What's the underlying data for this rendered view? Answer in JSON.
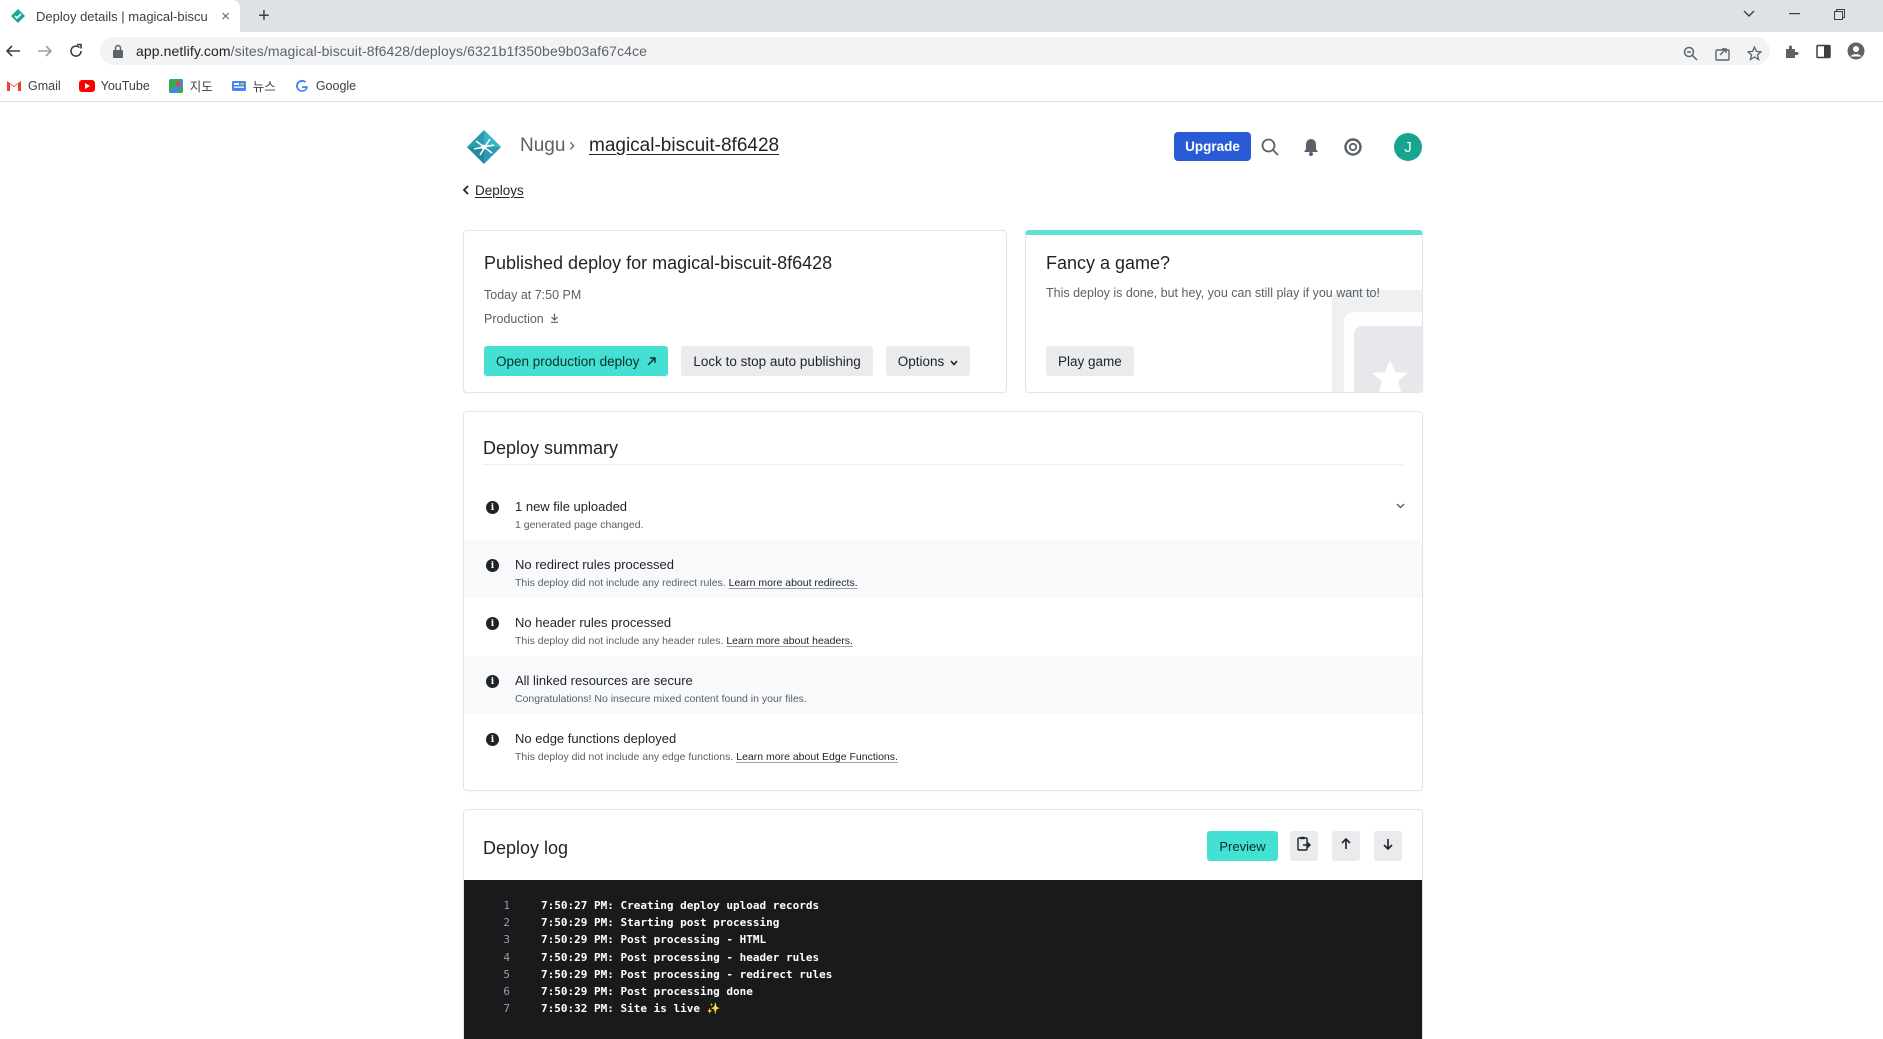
{
  "browser": {
    "tab_title": "Deploy details | magical-biscuit",
    "tab_close": "×",
    "new_tab": "+",
    "url_host": "app.netlify.com",
    "url_path": "/sites/magical-biscuit-8f6428/deploys/6321b1f350be9b03af67c4ce",
    "bookmarks": [
      {
        "label": "Gmail",
        "icon": "gmail-icon"
      },
      {
        "label": "YouTube",
        "icon": "youtube-icon"
      },
      {
        "label": "지도",
        "icon": "maps-icon"
      },
      {
        "label": "뉴스",
        "icon": "news-icon"
      },
      {
        "label": "Google",
        "icon": "google-icon"
      }
    ]
  },
  "header": {
    "team": "Nugu",
    "separator": "›",
    "site": "magical-biscuit-8f6428",
    "upgrade": "Upgrade",
    "avatar_initial": "J"
  },
  "back": {
    "label": "Deploys"
  },
  "deploy": {
    "title": "Published deploy for magical-biscuit-8f6428",
    "time": "Today at 7:50 PM",
    "context": "Production",
    "buttons": {
      "open": "Open production deploy",
      "lock": "Lock to stop auto publishing",
      "options": "Options"
    }
  },
  "game": {
    "title": "Fancy a game?",
    "text": "This deploy is done, but hey, you can still play if you want to!",
    "button": "Play game"
  },
  "summary": {
    "title": "Deploy summary",
    "rows": [
      {
        "heading": "1 new file uploaded",
        "sub": "1 generated page changed.",
        "link": ""
      },
      {
        "heading": "No redirect rules processed",
        "sub": "This deploy did not include any redirect rules.",
        "link": "Learn more about redirects."
      },
      {
        "heading": "No header rules processed",
        "sub": "This deploy did not include any header rules.",
        "link": "Learn more about headers."
      },
      {
        "heading": "All linked resources are secure",
        "sub": "Congratulations! No insecure mixed content found in your files.",
        "link": ""
      },
      {
        "heading": "No edge functions deployed",
        "sub": "This deploy did not include any edge functions.",
        "link": "Learn more about Edge Functions."
      }
    ]
  },
  "log": {
    "title": "Deploy log",
    "preview": "Preview",
    "lines": [
      {
        "n": "1",
        "text": "7:50:27 PM: Creating deploy upload records"
      },
      {
        "n": "2",
        "text": "7:50:29 PM: Starting post processing"
      },
      {
        "n": "3",
        "text": "7:50:29 PM: Post processing - HTML"
      },
      {
        "n": "4",
        "text": "7:50:29 PM: Post processing - header rules"
      },
      {
        "n": "5",
        "text": "7:50:29 PM: Post processing - redirect rules"
      },
      {
        "n": "6",
        "text": "7:50:29 PM: Post processing done"
      },
      {
        "n": "7",
        "text": "7:50:32 PM: Site is live ✨"
      }
    ]
  },
  "colors": {
    "accent_teal": "#43e0d3",
    "upgrade_blue": "#2a5bd7",
    "avatar_green": "#16a58f",
    "log_bg": "#181a1c"
  }
}
